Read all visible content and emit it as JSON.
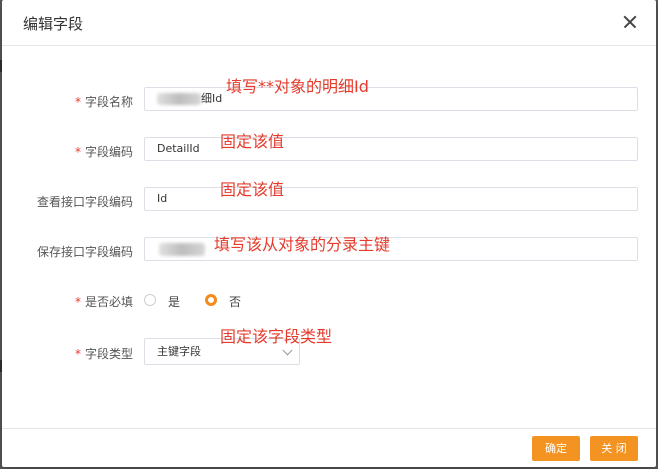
{
  "dialog": {
    "title": "编辑字段",
    "close_icon": "close-icon"
  },
  "form": {
    "required_mark": "*",
    "field_name": {
      "label": "字段名称",
      "value_suffix": "细Id"
    },
    "field_code": {
      "label": "字段编码",
      "value": "DetailId"
    },
    "query_code": {
      "label": "查看接口字段编码",
      "value": "Id"
    },
    "save_code": {
      "label": "保存接口字段编码"
    },
    "required": {
      "label": "是否必填",
      "options": [
        "是",
        "否"
      ],
      "selected": "否"
    },
    "field_type": {
      "label": "字段类型",
      "value": "主键字段",
      "icon": "chevron-down-icon"
    }
  },
  "annotations": {
    "name": "填写**对象的明细Id",
    "code": "固定该值",
    "query": "固定该值",
    "save": "填写该从对象的分录主键",
    "type": "固定该字段类型"
  },
  "footer": {
    "confirm": "确定",
    "close": "关 闭"
  },
  "colors": {
    "accent": "#f39422",
    "annotation": "#e53b2c",
    "required": "#e6392e"
  }
}
